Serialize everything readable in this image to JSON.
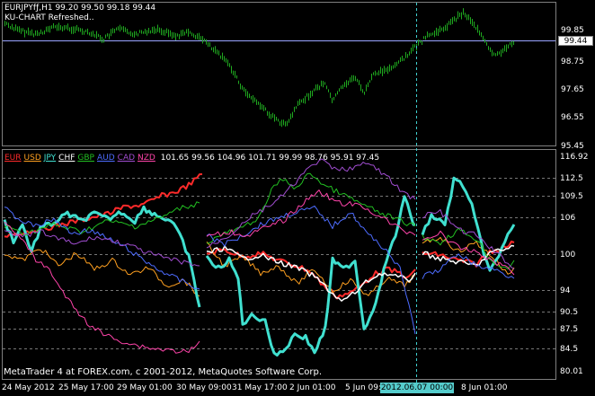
{
  "window": {
    "symbol_line": "EURJPYfƒ,H1  99.20 99.50 99.18 99.44",
    "status_line": "KU-CHART Refreshed..",
    "current_price": "99.44",
    "copyright": "MetaTrader 4 at FOREX.com, c 2001-2012, MetaQuotes Software Corp.",
    "cursor_date": "2012.06.07 00:00"
  },
  "indicator": {
    "legend": [
      {
        "name": "EUR",
        "color": "#ff2a2a"
      },
      {
        "name": "USD",
        "color": "#ffa020"
      },
      {
        "name": "JPY",
        "color": "#40e0d0"
      },
      {
        "name": "CHF",
        "color": "#ffffff"
      },
      {
        "name": "GBP",
        "color": "#22c022"
      },
      {
        "name": "AUD",
        "color": "#4d6cff"
      },
      {
        "name": "CAD",
        "color": "#a04dd0"
      },
      {
        "name": "NZD",
        "color": "#ff44aa"
      }
    ],
    "values_line": "101.65 99.56 104.96 101.71 99.99 98.76 95.91 97.45"
  },
  "price_axis": [
    "99.85",
    "98.75",
    "97.65",
    "96.55",
    "95.45"
  ],
  "indicator_axis": [
    "116.92",
    "112.5",
    "109.5",
    "106",
    "100",
    "94",
    "90.5",
    "87.5",
    "84.5",
    "80.01"
  ],
  "time_axis": [
    "24 May 2012",
    "25 May 17:00",
    "29 May 01:00",
    "30 May 09:00",
    "31 May 17:00",
    "2 Jun 01:00",
    "5 Jun 09:00",
    "8 Jun 01:00"
  ],
  "colors": {
    "background": "#000000",
    "candles": "#1fa81f",
    "grid": "#7f7f7f",
    "cursor_line": "#40d0d0"
  },
  "chart_data": [
    {
      "type": "bar",
      "title": "EURJPYfƒ,H1",
      "ylim": [
        95.45,
        100.5
      ],
      "x": [
        "24 May 2012",
        "25 May 17:00",
        "29 May 01:00",
        "30 May 09:00",
        "31 May 17:00",
        "2 Jun 01:00",
        "5 Jun 09:00",
        "8 Jun 01:00"
      ],
      "series": [
        {
          "name": "EURJPYfƒ",
          "values": [
            99.9,
            99.6,
            99.7,
            99.2,
            98.4,
            97.4,
            96.8,
            97.3,
            96.9,
            97.7,
            99.1,
            99.9,
            99.0,
            99.44
          ]
        }
      ]
    },
    {
      "type": "line",
      "ylim": [
        80.01,
        116.92
      ],
      "x": [
        "24 May 2012",
        "25 May 17:00",
        "29 May 01:00",
        "30 May 09:00",
        "31 May 17:00",
        "2 Jun 01:00",
        "5 Jun 09:00",
        "8 Jun 01:00"
      ],
      "series": [
        {
          "name": "EUR",
          "values": [
            101.65
          ]
        },
        {
          "name": "USD",
          "values": [
            99.56
          ]
        },
        {
          "name": "JPY",
          "values": [
            104.96
          ]
        },
        {
          "name": "CHF",
          "values": [
            101.71
          ]
        },
        {
          "name": "GBP",
          "values": [
            99.99
          ]
        },
        {
          "name": "AUD",
          "values": [
            98.76
          ]
        },
        {
          "name": "CAD",
          "values": [
            95.91
          ]
        },
        {
          "name": "NZD",
          "values": [
            97.45
          ]
        }
      ]
    }
  ]
}
